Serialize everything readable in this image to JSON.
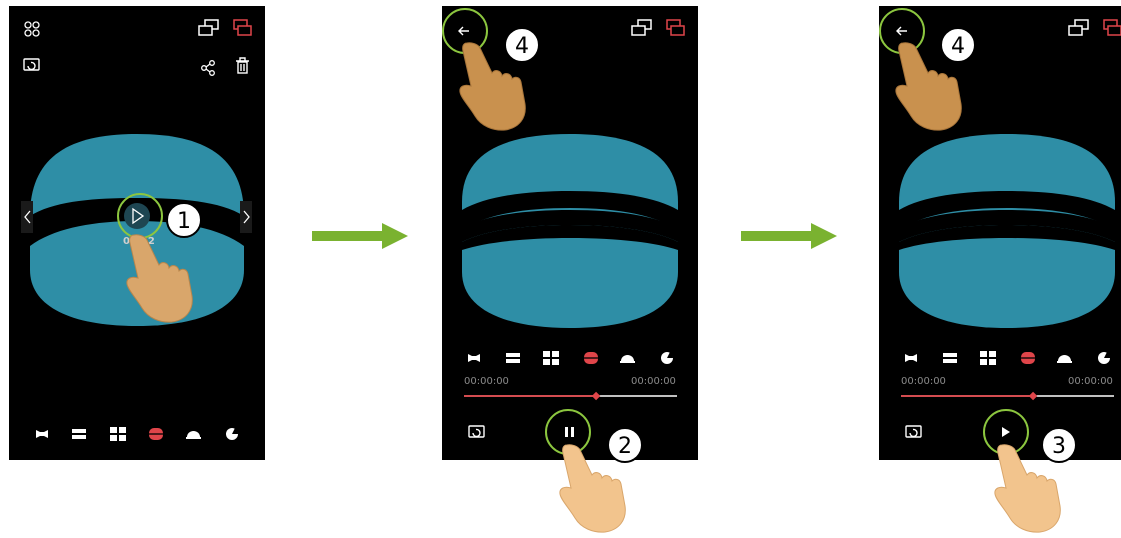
{
  "screens": [
    {
      "video_time": "00:12",
      "step_number": "1",
      "icons": [
        "grid-icon",
        "screen-mirror-icon",
        "camera-switch-icon",
        "rotate-icon",
        "share-icon",
        "trash-icon",
        "chevron-left-icon",
        "chevron-right-icon",
        "play-icon"
      ],
      "view_modes": [
        "panorama",
        "split-2",
        "split-4",
        "cylinder",
        "dome",
        "globe"
      ],
      "selected_view_mode": "cylinder"
    },
    {
      "time_start": "00:00:00",
      "time_end": "00:00:00",
      "progress": 0.62,
      "step_numbers": [
        "4",
        "2"
      ],
      "playback_state": "pause",
      "view_modes": [
        "panorama",
        "split-2",
        "split-4",
        "cylinder",
        "dome",
        "globe"
      ],
      "selected_view_mode": "cylinder"
    },
    {
      "time_start": "00:00:00",
      "time_end": "00:00:00",
      "progress": 0.62,
      "step_numbers": [
        "4",
        "3"
      ],
      "playback_state": "play",
      "view_modes": [
        "panorama",
        "split-2",
        "split-4",
        "cylinder",
        "dome",
        "globe"
      ],
      "selected_view_mode": "cylinder"
    }
  ],
  "colors": {
    "cylinder": "#2e8ea6",
    "accent_red": "#e0454a",
    "highlight_circle": "#8cc63f",
    "flow_arrow": "#7ab230",
    "finger": "#f2c48d"
  }
}
